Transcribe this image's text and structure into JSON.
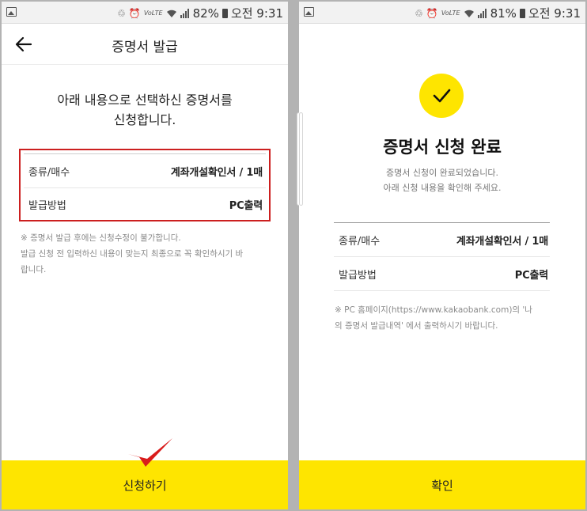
{
  "status_left": {
    "battery": "82%",
    "time": "오전 9:31",
    "volte": "VoLTE"
  },
  "status_right": {
    "battery": "81%",
    "time": "오전 9:31",
    "volte": "VoLTE"
  },
  "request_screen": {
    "title": "증명서 발급",
    "intro_line1": "아래 내용으로 선택하신 증명서를",
    "intro_line2": "신청합니다.",
    "rows": [
      {
        "label": "종류/매수",
        "value": "계좌개설확인서 / 1매"
      },
      {
        "label": "발급방법",
        "value": "PC출력"
      }
    ],
    "notice_line1": "※ 증명서 발급 후에는 신청수정이 불가합니다.",
    "notice_line2": "발급 신청 전 입력하신 내용이 맞는지 최종으로 꼭 확인하시기 바",
    "notice_line3": "랍니다.",
    "submit_label": "신청하기",
    "highlight_color": "#cc1f1f"
  },
  "complete_screen": {
    "title": "증명서 신청 완료",
    "sub_line1": "증명서 신청이 완료되었습니다.",
    "sub_line2": "아래 신청 내용을 확인해 주세요.",
    "rows": [
      {
        "label": "종류/매수",
        "value": "계좌개설확인서 / 1매"
      },
      {
        "label": "발급방법",
        "value": "PC출력"
      }
    ],
    "notice_line1": "※ PC 홈페이지(https://www.kakaobank.com)의 '나",
    "notice_line2": "의 증명서 발급내역' 에서 출력하시기 바랍니다.",
    "confirm_label": "확인"
  },
  "colors": {
    "accent_yellow": "#fee500",
    "background": "#ffffff",
    "frame": "#b3b3b3"
  }
}
